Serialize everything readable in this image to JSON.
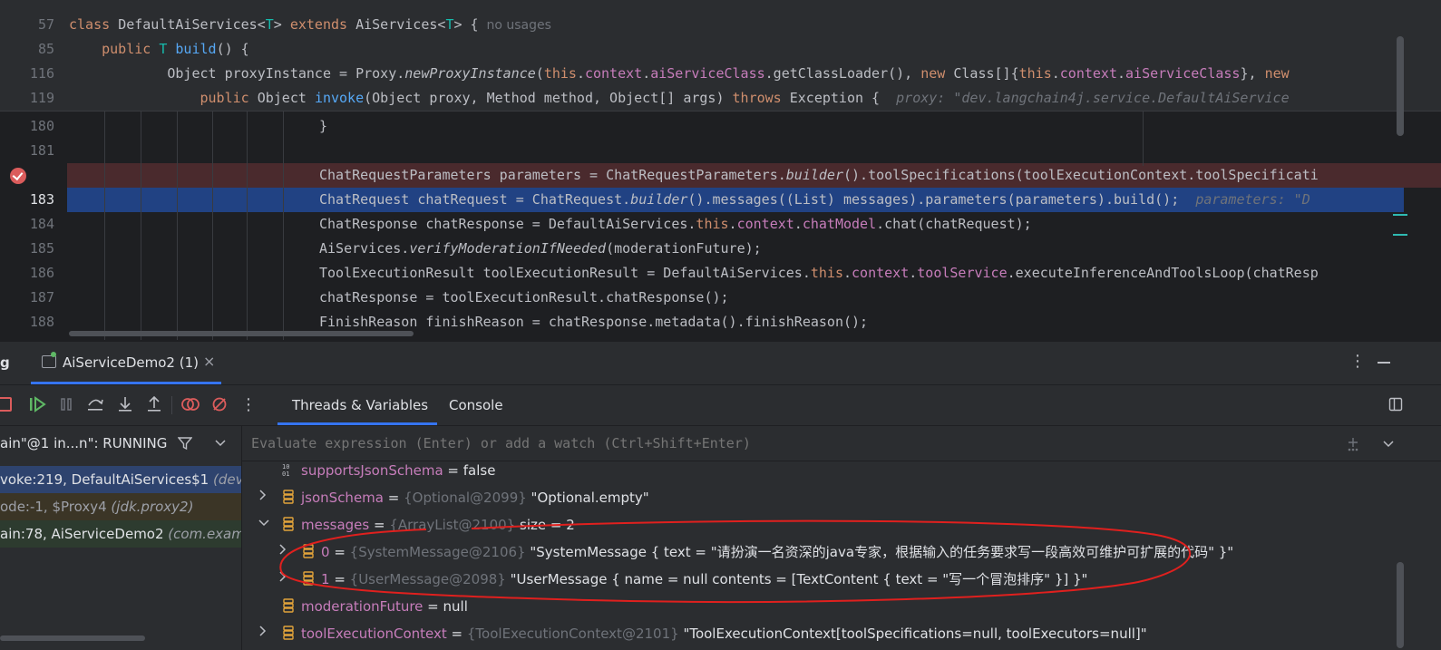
{
  "editor": {
    "sticky": [
      {
        "num": "57",
        "pre": "",
        "tokens": [
          {
            "t": "class ",
            "c": "kw"
          },
          {
            "t": "DefaultAiServices<",
            "c": ""
          },
          {
            "t": "T",
            "c": "tp"
          },
          {
            "t": "> ",
            "c": ""
          },
          {
            "t": "extends ",
            "c": "kw"
          },
          {
            "t": "AiServices<",
            "c": ""
          },
          {
            "t": "T",
            "c": "tp"
          },
          {
            "t": "> {",
            "c": ""
          }
        ],
        "note": "no usages"
      },
      {
        "num": "85",
        "pre": "    ",
        "tokens": [
          {
            "t": "public ",
            "c": "kw"
          },
          {
            "t": "T ",
            "c": "tp"
          },
          {
            "t": "build",
            "c": "fn"
          },
          {
            "t": "() {",
            "c": ""
          }
        ]
      },
      {
        "num": "116",
        "pre": "            ",
        "tokens": [
          {
            "t": "Object proxyInstance = Proxy.",
            "c": ""
          },
          {
            "t": "newProxyInstance",
            "c": "it"
          },
          {
            "t": "(",
            "c": ""
          },
          {
            "t": "this",
            "c": "kw"
          },
          {
            "t": ".",
            "c": ""
          },
          {
            "t": "context",
            "c": "fld"
          },
          {
            "t": ".",
            "c": ""
          },
          {
            "t": "aiServiceClass",
            "c": "fld"
          },
          {
            "t": ".getClassLoader(), ",
            "c": ""
          },
          {
            "t": "new ",
            "c": "kw"
          },
          {
            "t": "Class[]{",
            "c": ""
          },
          {
            "t": "this",
            "c": "kw"
          },
          {
            "t": ".",
            "c": ""
          },
          {
            "t": "context",
            "c": "fld"
          },
          {
            "t": ".",
            "c": ""
          },
          {
            "t": "aiServiceClass",
            "c": "fld"
          },
          {
            "t": "}, ",
            "c": ""
          },
          {
            "t": "new ",
            "c": "kw"
          }
        ]
      },
      {
        "num": "119",
        "pre": "                ",
        "tokens": [
          {
            "t": "public ",
            "c": "kw"
          },
          {
            "t": "Object ",
            "c": ""
          },
          {
            "t": "invoke",
            "c": "fn"
          },
          {
            "t": "(Object proxy, Method method, Object[] args) ",
            "c": ""
          },
          {
            "t": "throws ",
            "c": "kw"
          },
          {
            "t": "Exception {  ",
            "c": ""
          },
          {
            "t": "proxy: \"dev.langchain4j.service.DefaultAiService",
            "c": "hint"
          }
        ]
      }
    ],
    "lines": [
      {
        "num": "180",
        "tokens": [
          {
            "t": "}",
            "c": ""
          }
        ]
      },
      {
        "num": "181",
        "tokens": []
      },
      {
        "num": "",
        "tokens": [
          {
            "t": "ChatRequestParameters parameters = ChatRequestParameters.",
            "c": ""
          },
          {
            "t": "builder",
            "c": "it"
          },
          {
            "t": "().toolSpecifications(toolExecutionContext.toolSpecificati",
            "c": ""
          }
        ]
      },
      {
        "num": "183",
        "tokens": [
          {
            "t": "ChatRequest chatRequest = ChatRequest.",
            "c": ""
          },
          {
            "t": "builder",
            "c": "it"
          },
          {
            "t": "().messages((List) messages).parameters(parameters).build();  ",
            "c": ""
          },
          {
            "t": "parameters: \"D",
            "c": "hint"
          }
        ]
      },
      {
        "num": "184",
        "tokens": [
          {
            "t": "ChatResponse chatResponse = DefaultAiServices.",
            "c": ""
          },
          {
            "t": "this",
            "c": "kw"
          },
          {
            "t": ".",
            "c": ""
          },
          {
            "t": "context",
            "c": "fld"
          },
          {
            "t": ".",
            "c": ""
          },
          {
            "t": "chatModel",
            "c": "fld"
          },
          {
            "t": ".chat(chatRequest);",
            "c": ""
          }
        ]
      },
      {
        "num": "185",
        "tokens": [
          {
            "t": "AiServices.",
            "c": ""
          },
          {
            "t": "verifyModerationIfNeeded",
            "c": "it"
          },
          {
            "t": "(moderationFuture);",
            "c": ""
          }
        ]
      },
      {
        "num": "186",
        "tokens": [
          {
            "t": "ToolExecutionResult toolExecutionResult = DefaultAiServices.",
            "c": ""
          },
          {
            "t": "this",
            "c": "kw"
          },
          {
            "t": ".",
            "c": ""
          },
          {
            "t": "context",
            "c": "fld"
          },
          {
            "t": ".",
            "c": ""
          },
          {
            "t": "toolService",
            "c": "fld"
          },
          {
            "t": ".executeInferenceAndToolsLoop(chatResp",
            "c": ""
          }
        ]
      },
      {
        "num": "187",
        "tokens": [
          {
            "t": "chatResponse = toolExecutionResult.chatResponse();",
            "c": ""
          }
        ]
      },
      {
        "num": "188",
        "tokens": [
          {
            "t": "FinishReason finishReason = chatResponse.metadata().finishReason();",
            "c": ""
          }
        ]
      }
    ]
  },
  "debug": {
    "panel_label": "g",
    "run_tab": "AiServiceDemo2 (1)",
    "tabs": [
      "Threads & Variables",
      "Console"
    ],
    "thread_selector": "ain\"@1 in...n\": RUNNING",
    "frames": [
      {
        "main": "voke:219, DefaultAiServices$1 ",
        "pkg": "(dev.la"
      },
      {
        "main": "ode:-1, $Proxy4 ",
        "pkg": "(jdk.proxy2)"
      },
      {
        "main": "ain:78, AiServiceDemo2 ",
        "pkg": "(com.examp"
      }
    ],
    "eval_placeholder": "Evaluate expression (Enter) or add a watch (Ctrl+Shift+Enter)",
    "variables": [
      {
        "indent": 0,
        "expand": "",
        "icon": "bool",
        "name": "supportsJsonSchema",
        "type": "",
        "value": "false"
      },
      {
        "indent": 0,
        "expand": ">",
        "icon": "obj",
        "name": "jsonSchema",
        "type": "{Optional@2099}",
        "value": "\"Optional.empty\""
      },
      {
        "indent": 0,
        "expand": "v",
        "icon": "obj",
        "name": "messages",
        "type": "{ArrayList@2100}",
        "value": " size = 2"
      },
      {
        "indent": 1,
        "expand": ">",
        "icon": "obj",
        "name": "0",
        "type": "{SystemMessage@2106}",
        "value": "\"SystemMessage { text = \"请扮演一名资深的java专家，根据输入的任务要求写一段高效可维护可扩展的代码\" }\""
      },
      {
        "indent": 1,
        "expand": ">",
        "icon": "obj",
        "name": "1",
        "type": "{UserMessage@2098}",
        "value": "\"UserMessage { name = null contents = [TextContent { text = \"写一个冒泡排序\" }] }\""
      },
      {
        "indent": 0,
        "expand": "",
        "icon": "obj",
        "name": "moderationFuture",
        "type": "",
        "value": "null"
      },
      {
        "indent": 0,
        "expand": ">",
        "icon": "obj",
        "name": "toolExecutionContext",
        "type": "{ToolExecutionContext@2101}",
        "value": "\"ToolExecutionContext[toolSpecifications=null, toolExecutors=null]\""
      }
    ]
  },
  "colors": {
    "accent": "#3574f0",
    "breakpoint": "#db5c5c",
    "annotation": "#e0201e",
    "current_line": "#214283"
  }
}
